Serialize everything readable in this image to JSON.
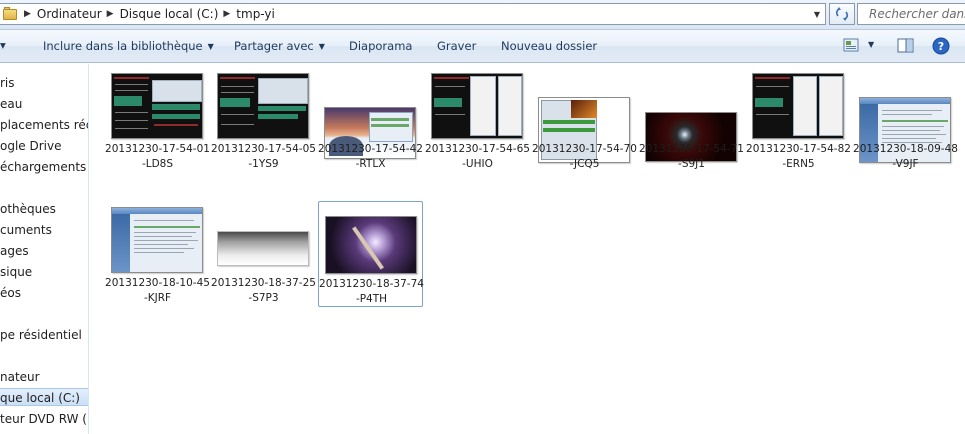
{
  "address_bar": {
    "breadcrumbs": [
      "Ordinateur",
      "Disque local (C:)",
      "tmp-yi"
    ],
    "search_placeholder": "Rechercher dans..."
  },
  "toolbar": {
    "items": [
      {
        "label": "Inclure dans la bibliothèque",
        "has_dropdown": true
      },
      {
        "label": "Partager avec",
        "has_dropdown": true
      },
      {
        "label": "Diaporama",
        "has_dropdown": false
      },
      {
        "label": "Graver",
        "has_dropdown": false
      },
      {
        "label": "Nouveau dossier",
        "has_dropdown": false
      }
    ],
    "icons": [
      "views-icon",
      "preview-pane-icon",
      "help-icon"
    ]
  },
  "nav_pane": {
    "items": [
      {
        "label": "ris",
        "selected": false
      },
      {
        "label": "eau",
        "selected": false
      },
      {
        "label": "placements récen",
        "selected": false
      },
      {
        "label": "ogle Drive",
        "selected": false
      },
      {
        "label": "échargements",
        "selected": false
      },
      {
        "label": "othèques",
        "selected": false
      },
      {
        "label": "cuments",
        "selected": false
      },
      {
        "label": "ages",
        "selected": false
      },
      {
        "label": "sique",
        "selected": false
      },
      {
        "label": "éos",
        "selected": false
      },
      {
        "label": "pe résidentiel",
        "selected": false
      },
      {
        "label": "nateur",
        "selected": false
      },
      {
        "label": "que local (C:)",
        "selected": true
      },
      {
        "label": "teur DVD RW (D:)",
        "selected": false
      }
    ]
  },
  "files": [
    {
      "name": "20131230-17-54-01-LD8S",
      "thumb": "gpu-monitor"
    },
    {
      "name": "20131230-17-54-05-1YS9",
      "thumb": "gpu-monitor"
    },
    {
      "name": "20131230-17-54-42-RTLX",
      "thumb": "desktop-sunset"
    },
    {
      "name": "20131230-17-54-65-UHIO",
      "thumb": "gpu-monitor-2"
    },
    {
      "name": "20131230-17-54-70-JCQ5",
      "thumb": "gpu-tool"
    },
    {
      "name": "20131230-17-54-71-S9J1",
      "thumb": "eye-dark"
    },
    {
      "name": "20131230-17-54-82-ERN5",
      "thumb": "gpu-monitor"
    },
    {
      "name": "20131230-18-09-48-V9JF",
      "thumb": "window-app"
    },
    {
      "name": "20131230-18-10-45-KJRF",
      "thumb": "window-app-2"
    },
    {
      "name": "20131230-18-37-25-S7P3",
      "thumb": "gradient-strip"
    },
    {
      "name": "20131230-18-37-74-P4TH",
      "thumb": "fantasy-art",
      "selected": true
    }
  ]
}
